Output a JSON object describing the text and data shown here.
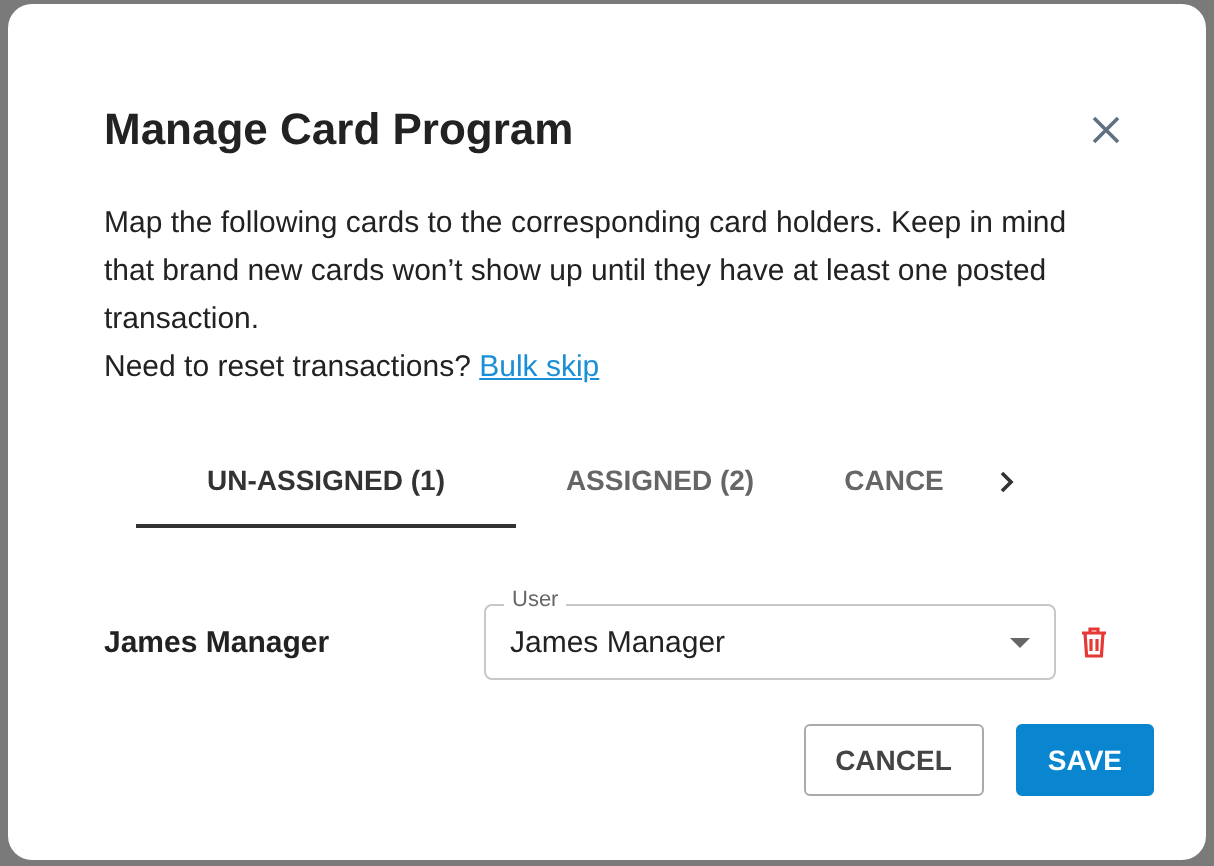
{
  "dialog": {
    "title": "Manage Card Program",
    "description": "Map the following cards to the corresponding card holders. Keep in mind that brand new cards won’t show up until they have at least one posted transaction.",
    "reset_prompt": "Need to reset transactions?",
    "reset_link": "Bulk skip",
    "tabs": [
      {
        "label": "UN-ASSIGNED (1)",
        "selected": true
      },
      {
        "label": "ASSIGNED (2)",
        "selected": false
      },
      {
        "label": "CANCE",
        "selected": false
      }
    ],
    "rows": [
      {
        "cardholder": "James Manager",
        "field_label": "User",
        "value": "James Manager"
      }
    ],
    "buttons": [
      {
        "label": "CANCEL",
        "kind": "outlined"
      },
      {
        "label": "SAVE",
        "kind": "primary"
      }
    ]
  }
}
